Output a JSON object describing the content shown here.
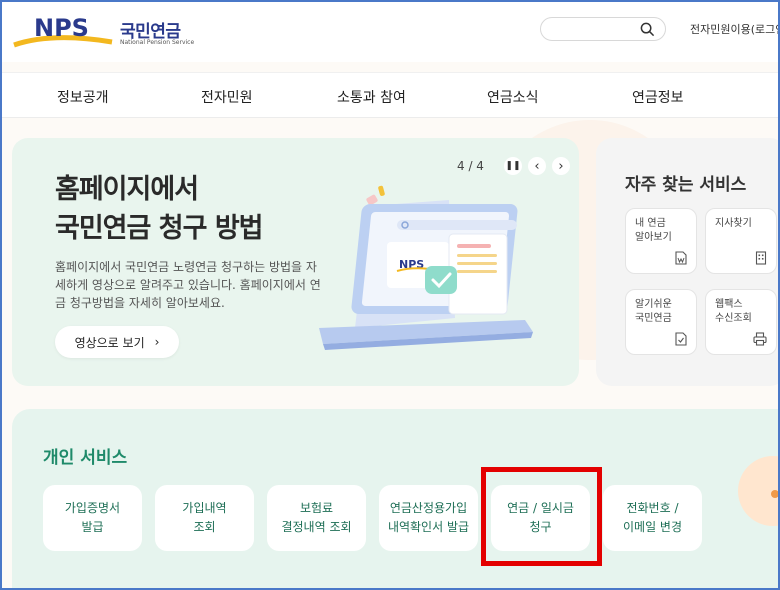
{
  "header": {
    "logo_text": "NPS",
    "logo_korean": "국민연금",
    "logo_english": "National Pension Service",
    "search_placeholder": "",
    "util_link": "전자민원이용(로그인"
  },
  "nav": {
    "items": [
      "정보공개",
      "전자민원",
      "소통과 참여",
      "연금소식",
      "연금정보"
    ]
  },
  "hero": {
    "title_line1": "홈페이지에서",
    "title_line2": "국민연금 청구 방법",
    "description": "홈페이지에서 국민연금 노령연금 청구하는 방법을 자세하게 영상으로 알려주고 있습니다. 홈페이지에서 연금 청구방법을 자세히 알아보세요.",
    "button_label": "영상으로 보기",
    "button_arrow": "›",
    "pager_count": "4 / 4",
    "pause_label": "❚❚",
    "prev_label": "‹",
    "next_label": "›",
    "illustration_logo": "NPS"
  },
  "quick_services": {
    "title": "자주 찾는 서비스",
    "items": [
      {
        "label": "내 연금\n알아보기",
        "icon": "document-w-icon"
      },
      {
        "label": "지사찾기",
        "icon": "building-icon"
      },
      {
        "label": "알기쉬운\n국민연금",
        "icon": "document-check-icon"
      },
      {
        "label": "웹팩스\n수신조회",
        "icon": "printer-icon"
      }
    ]
  },
  "personal": {
    "title": "개인 서비스",
    "items": [
      "가입증명서\n발급",
      "가입내역\n조회",
      "보험료\n결정내역 조회",
      "연금산정용가입\n내역확인서 발급",
      "연금 / 일시금\n청구",
      "전화번호 /\n이메일 변경"
    ]
  },
  "colors": {
    "brand_blue": "#2a3a8c",
    "brand_yellow": "#f3b81f",
    "accent_green": "#1f8a6a",
    "highlight_red": "#e30000"
  }
}
